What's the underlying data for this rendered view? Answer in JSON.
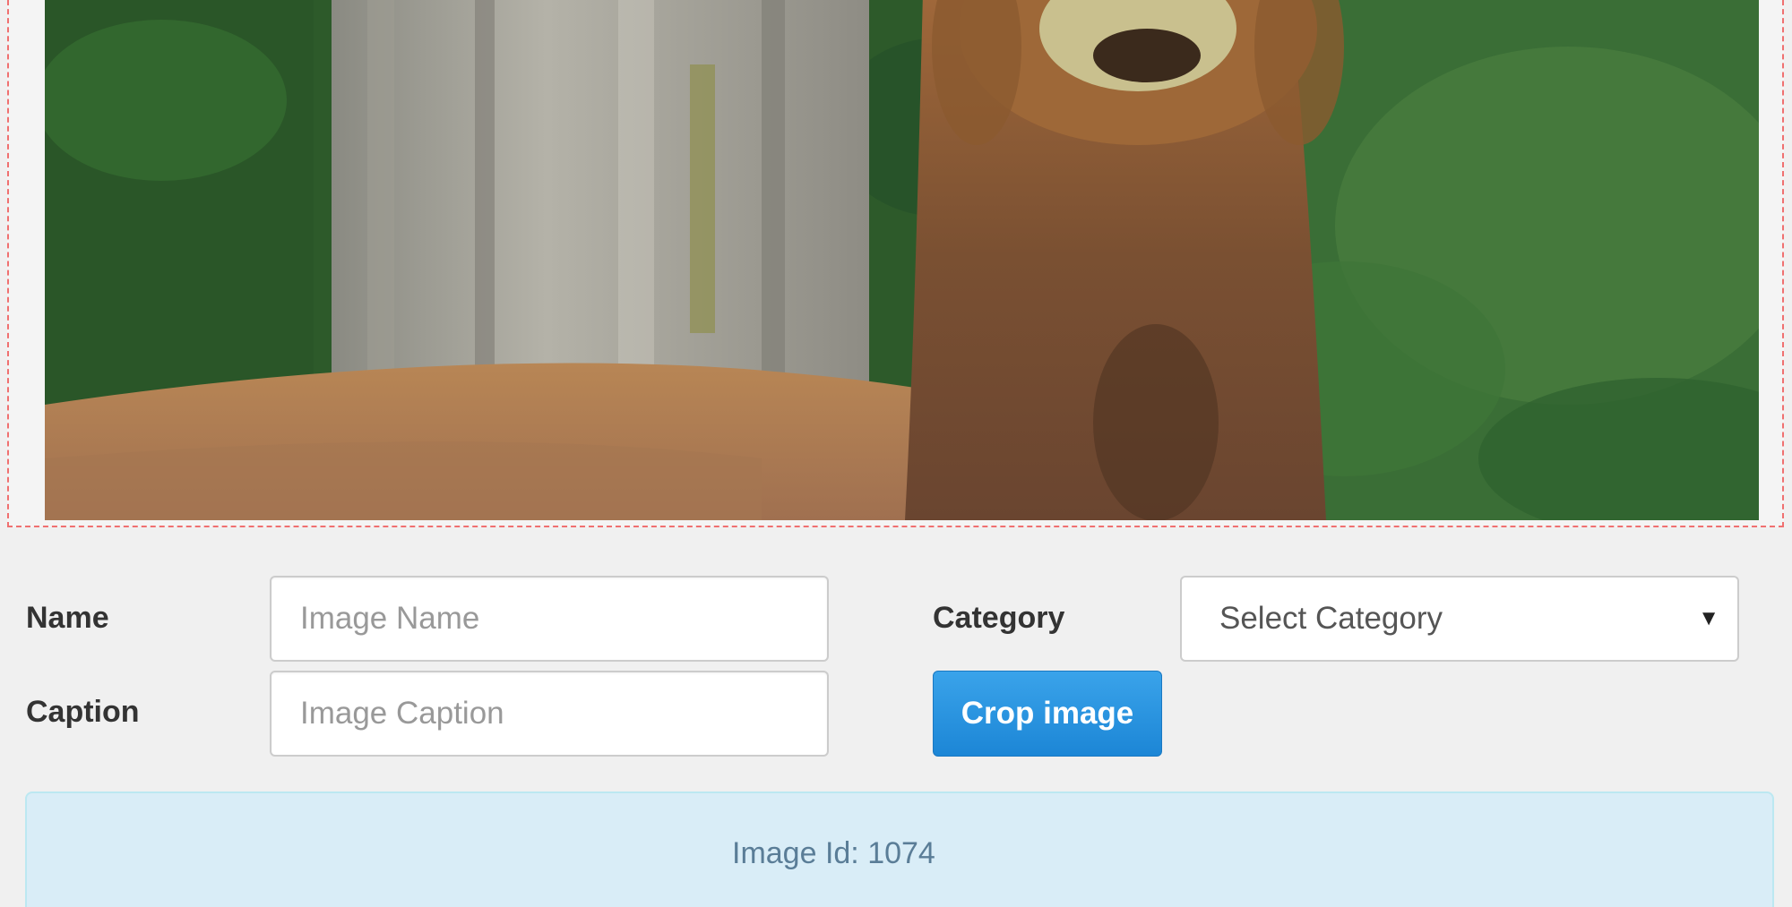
{
  "form": {
    "name_label": "Name",
    "name_placeholder": "Image Name",
    "name_value": "",
    "caption_label": "Caption",
    "caption_placeholder": "Image Caption",
    "caption_value": "",
    "category_label": "Category",
    "category_selected": "Select Category",
    "crop_button_label": "Crop image"
  },
  "info": {
    "image_id_text": "Image Id: 1074"
  },
  "icons": {
    "dropdown": "caret-down-icon"
  },
  "colors": {
    "button_primary": "#1c86d6",
    "info_background": "#d9edf7",
    "crop_border": "#f07070"
  }
}
